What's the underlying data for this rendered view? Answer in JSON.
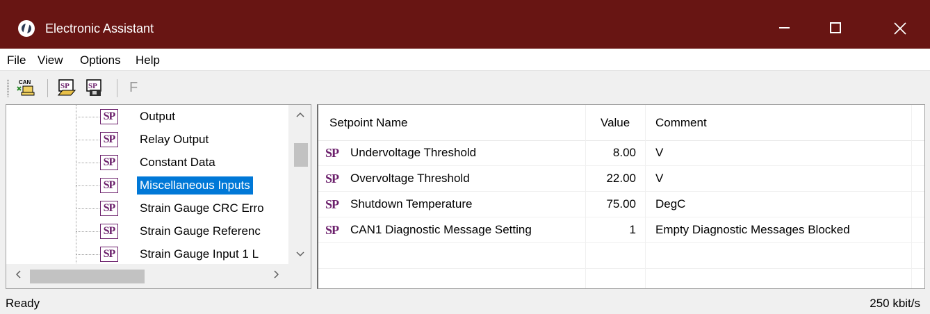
{
  "window": {
    "title": "Electronic Assistant"
  },
  "window_controls": {
    "minimize": "—",
    "maximize": "☐",
    "close": "✕"
  },
  "menu": [
    "File",
    "View",
    "Options",
    "Help"
  ],
  "toolbar": {
    "buttons": [
      {
        "icon": "can-connect-icon",
        "label": "CAN"
      },
      {
        "icon": "setpoint-open-icon",
        "label": "SP"
      },
      {
        "icon": "setpoint-save-icon",
        "label": "SP"
      }
    ],
    "flash_label": "F"
  },
  "tree": {
    "sp_badge": "SP",
    "items": [
      {
        "label": "Output",
        "selected": false
      },
      {
        "label": "Relay Output",
        "selected": false
      },
      {
        "label": "Constant Data",
        "selected": false
      },
      {
        "label": "Miscellaneous Inputs",
        "selected": true
      },
      {
        "label": "Strain Gauge CRC Erro",
        "selected": false
      },
      {
        "label": "Strain Gauge Referenc",
        "selected": false
      },
      {
        "label": "Strain Gauge Input 1 L",
        "selected": false
      }
    ],
    "scroll_up": "^",
    "scroll_down": "v",
    "scroll_left": "<",
    "scroll_right": ">"
  },
  "setpoints": {
    "columns": [
      "Setpoint Name",
      "Value",
      "Comment"
    ],
    "sp_badge": "SP",
    "rows": [
      {
        "name": "Undervoltage Threshold",
        "value": "8.00",
        "comment": "V"
      },
      {
        "name": "Overvoltage Threshold",
        "value": "22.00",
        "comment": "V"
      },
      {
        "name": "Shutdown Temperature",
        "value": "75.00",
        "comment": "DegC"
      },
      {
        "name": "CAN1 Diagnostic Message Setting",
        "value": "1",
        "comment": "Empty Diagnostic Messages Blocked"
      }
    ]
  },
  "status": {
    "text": "Ready",
    "baud": "250 kbit/s"
  },
  "colors": {
    "titlebar": "#681513",
    "selection": "#0078d7",
    "sp_purple": "#6b1f6b"
  }
}
